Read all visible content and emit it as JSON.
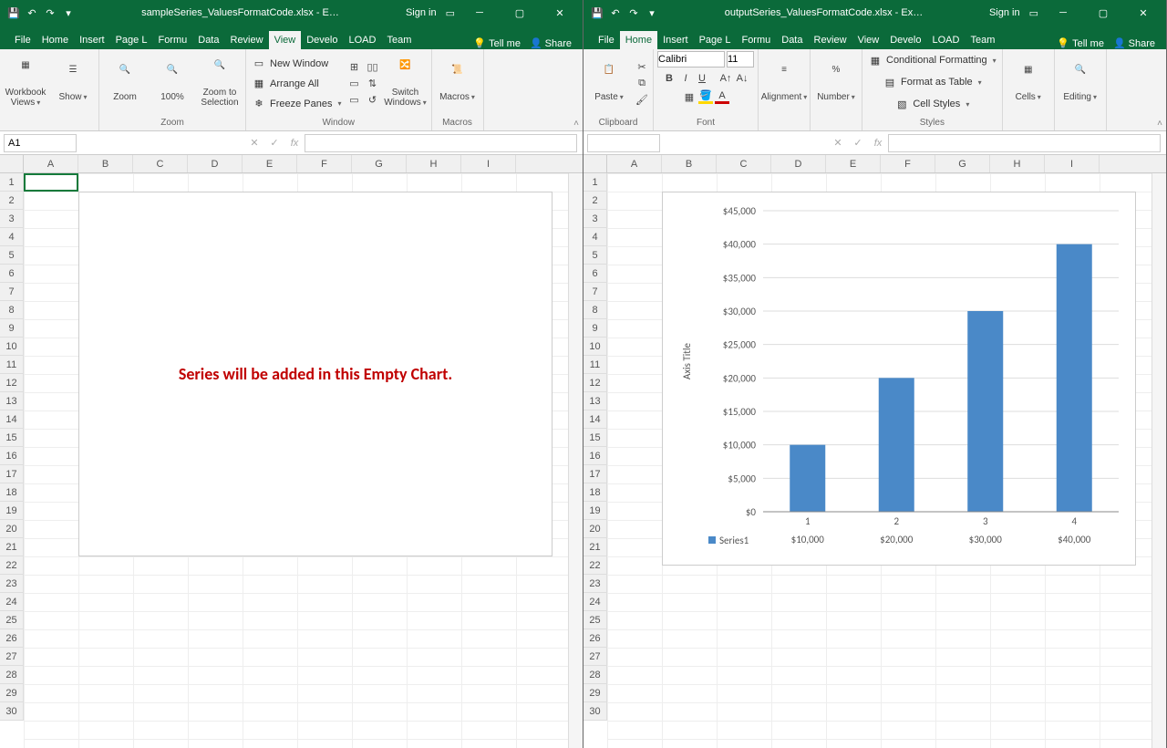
{
  "left": {
    "title": "sampleSeries_ValuesFormatCode.xlsx - E…",
    "signin": "Sign in",
    "tabs": [
      "File",
      "Home",
      "Insert",
      "Page L",
      "Formu",
      "Data",
      "Review",
      "View",
      "Develo",
      "LOAD",
      "Team"
    ],
    "active_tab": "View",
    "tellme": "Tell me",
    "share": "Share",
    "groups": {
      "workbook_views": "Workbook Views",
      "show": "Show",
      "zoom": "Zoom",
      "zoom_btn": "Zoom",
      "zoom100": "100%",
      "zoom_sel1": "Zoom to",
      "zoom_sel2": "Selection",
      "new_window": "New Window",
      "arrange_all": "Arrange All",
      "freeze": "Freeze Panes",
      "window": "Window",
      "switch1": "Switch",
      "switch2": "Windows",
      "macros": "Macros",
      "macros_grp": "Macros"
    },
    "cell_ref": "A1",
    "cols": [
      "A",
      "B",
      "C",
      "D",
      "E",
      "F",
      "G",
      "H",
      "I"
    ],
    "rows": 30,
    "chart_text": "Series will be added in this Empty Chart."
  },
  "right": {
    "title": "outputSeries_ValuesFormatCode.xlsx - Ex…",
    "signin": "Sign in",
    "tabs": [
      "File",
      "Home",
      "Insert",
      "Page L",
      "Formu",
      "Data",
      "Review",
      "View",
      "Develo",
      "LOAD",
      "Team"
    ],
    "active_tab": "Home",
    "tellme": "Tell me",
    "share": "Share",
    "groups": {
      "paste": "Paste",
      "clipboard": "Clipboard",
      "font": "Font",
      "fontname": "Calibri",
      "fontsize": "11",
      "alignment": "Alignment",
      "number": "Number",
      "cond": "Conditional Formatting",
      "table": "Format as Table",
      "styles_btn": "Cell Styles",
      "styles": "Styles",
      "cells": "Cells",
      "editing": "Editing"
    },
    "cell_ref": "",
    "cols": [
      "A",
      "B",
      "C",
      "D",
      "E",
      "F",
      "G",
      "H",
      "I"
    ],
    "rows": 30
  },
  "chart_data": {
    "type": "bar",
    "categories": [
      "1",
      "2",
      "3",
      "4"
    ],
    "values": [
      10000,
      20000,
      30000,
      40000
    ],
    "series_name": "Series1",
    "ylabel": "Axis Title",
    "ylim": [
      0,
      45000
    ],
    "yticks": [
      "$0",
      "$5,000",
      "$10,000",
      "$15,000",
      "$20,000",
      "$25,000",
      "$30,000",
      "$35,000",
      "$40,000",
      "$45,000"
    ],
    "data_labels": [
      "$10,000",
      "$20,000",
      "$30,000",
      "$40,000"
    ]
  }
}
